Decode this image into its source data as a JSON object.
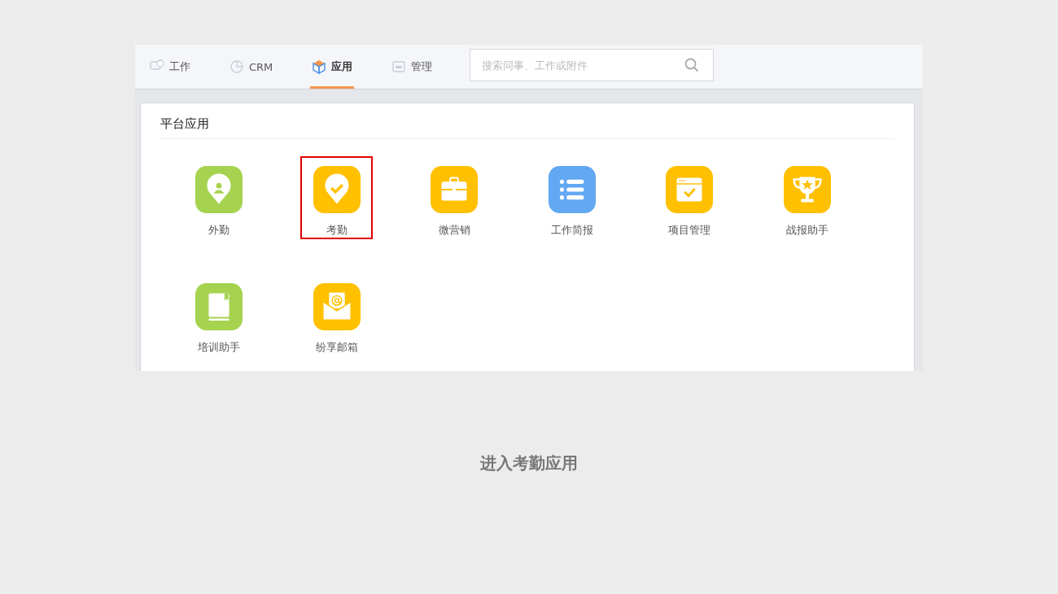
{
  "nav": {
    "tabs": [
      {
        "label": "工作",
        "kind": "chat",
        "selected": false
      },
      {
        "label": "CRM",
        "kind": "pie",
        "selected": false
      },
      {
        "label": "应用",
        "kind": "cube",
        "selected": true
      },
      {
        "label": "管理",
        "kind": "card",
        "selected": false
      }
    ],
    "search": {
      "placeholder": "搜索同事、工作或附件"
    }
  },
  "section": {
    "title": "平台应用",
    "apps": [
      {
        "label": "外勤",
        "kind": "pin-person",
        "color": "#a6d34f",
        "selected": false
      },
      {
        "label": "考勤",
        "kind": "pin-check",
        "color": "#ffc000",
        "selected": true
      },
      {
        "label": "微营销",
        "kind": "briefcase",
        "color": "#ffc000",
        "selected": false
      },
      {
        "label": "工作简报",
        "kind": "list",
        "color": "#62a8f3",
        "selected": false
      },
      {
        "label": "项目管理",
        "kind": "window-check",
        "color": "#ffc000",
        "selected": false
      },
      {
        "label": "战报助手",
        "kind": "trophy",
        "color": "#ffc000",
        "selected": false
      },
      {
        "label": "培训助手",
        "kind": "book",
        "color": "#a6d34f",
        "selected": false
      },
      {
        "label": "纷享邮箱",
        "kind": "mail",
        "color": "#ffc000",
        "selected": false
      }
    ]
  },
  "caption": "进入考勤应用"
}
